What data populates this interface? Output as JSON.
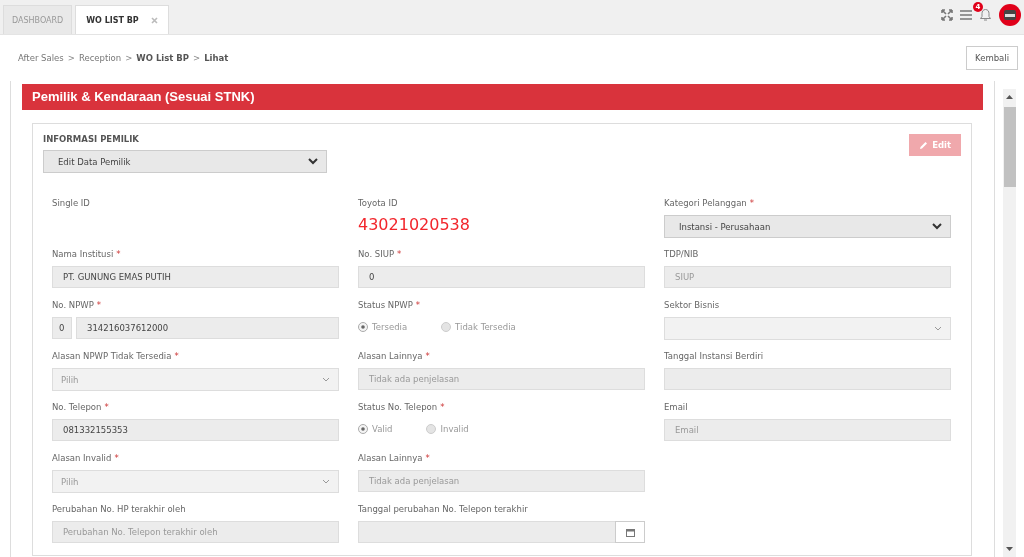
{
  "tabs": [
    {
      "label": "DASHBOARD",
      "selected": false,
      "closable": false
    },
    {
      "label": "WO LIST BP",
      "selected": true,
      "closable": true
    }
  ],
  "header": {
    "notification_count": "4"
  },
  "breadcrumb": {
    "items": [
      "After Sales",
      "Reception",
      "WO List BP",
      "Lihat"
    ],
    "separator": ">"
  },
  "back_button": "Kembali",
  "section": {
    "title": "Pemilik & Kendaraan (Sesuai STNK)",
    "owner_info": {
      "label": "INFORMASI PEMILIK",
      "select_value": "Edit Data Pemilik"
    },
    "edit_button": {
      "label": "Edit",
      "disabled": true
    },
    "rows": [
      {
        "fields": [
          {
            "kind": "label",
            "label": "Single ID"
          },
          {
            "kind": "id",
            "label": "Toyota ID",
            "value": "43021020538"
          },
          {
            "kind": "select",
            "label": "Kategori Pelanggan",
            "required_mark": "*",
            "value": "Instansi - Perusahaan",
            "disabled": false
          }
        ]
      },
      {
        "fields": [
          {
            "kind": "text",
            "label": "Nama Institusi",
            "required_mark": "*",
            "value": "PT. GUNUNG EMAS PUTIH"
          },
          {
            "kind": "text",
            "label": "No. SIUP",
            "required_mark": "*",
            "value": "0"
          },
          {
            "kind": "text",
            "label": "TDP/NIB",
            "placeholder": "SIUP"
          }
        ]
      },
      {
        "fields": [
          {
            "kind": "npwp",
            "label": "No. NPWP",
            "required_mark": "*",
            "prefix": "0",
            "value": "314216037612000"
          },
          {
            "kind": "radio",
            "label": "Status NPWP",
            "required_mark": "*",
            "options": [
              {
                "label": "Tersedia",
                "selected": true
              },
              {
                "label": "Tidak Tersedia",
                "selected": false
              }
            ]
          },
          {
            "kind": "select",
            "label": "Sektor Bisnis",
            "disabled": true
          }
        ]
      },
      {
        "fields": [
          {
            "kind": "select",
            "label": "Alasan NPWP Tidak Tersedia",
            "required_mark": "*",
            "placeholder": "Pilih",
            "disabled": true
          },
          {
            "kind": "text",
            "label": "Alasan Lainnya",
            "required_mark": "*",
            "placeholder": "Tidak ada penjelasan"
          },
          {
            "kind": "text",
            "label": "Tanggal Instansi Berdiri"
          }
        ]
      },
      {
        "fields": [
          {
            "kind": "text",
            "label": "No. Telepon",
            "required_mark": "*",
            "value": "081332155353"
          },
          {
            "kind": "radio",
            "label": "Status No. Telepon",
            "required_mark": "*",
            "options": [
              {
                "label": "Valid",
                "selected": true
              },
              {
                "label": "Invalid",
                "selected": false
              }
            ]
          },
          {
            "kind": "text",
            "label": "Email",
            "placeholder": "Email"
          }
        ]
      },
      {
        "fields": [
          {
            "kind": "select",
            "label": "Alasan Invalid",
            "required_mark": "*",
            "placeholder": "Pilih",
            "disabled": true
          },
          {
            "kind": "text",
            "label": "Alasan Lainnya",
            "required_mark": "*",
            "placeholder": "Tidak ada penjelasan"
          }
        ]
      },
      {
        "fields": [
          {
            "kind": "text",
            "label": "Perubahan No. HP terakhir oleh",
            "placeholder": "Perubahan No. Telepon terakhir oleh"
          },
          {
            "kind": "date",
            "label": "Tanggal perubahan No. Telepon terakhir"
          }
        ]
      }
    ]
  }
}
